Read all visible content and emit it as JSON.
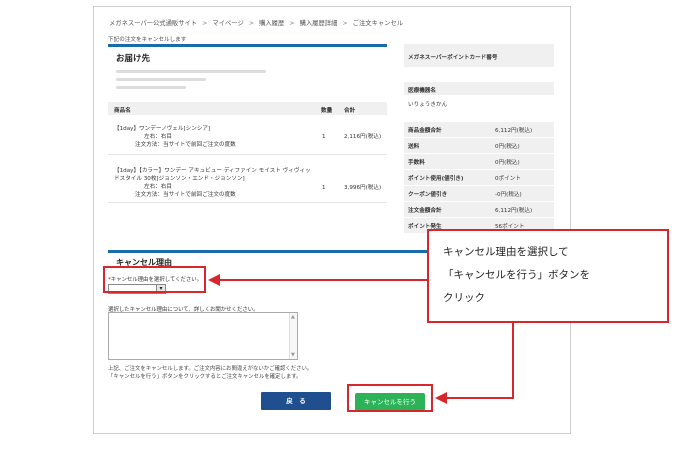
{
  "breadcrumb": {
    "items": [
      "メガネスーパー公式通販サイト",
      "マイページ",
      "購入履歴",
      "購入履歴詳細",
      "ご注文キャンセル"
    ],
    "separator": ">"
  },
  "top_note": "下記の注文をキャンセルします",
  "shipping": {
    "title": "お届け先"
  },
  "items": {
    "headers": {
      "name": "商品名",
      "qty": "数量",
      "total": "合計"
    },
    "rows": [
      {
        "name": "【1day】ワンデーノヴェル[シンシア]",
        "side": "左右：右目",
        "method": "注文方法：当サイトで前回ご注文の度数",
        "qty": "1",
        "price": "2,116円(税込)"
      },
      {
        "name": "【1day】【カラー】ワンデー アキュビュー ディファイン モイスト ヴィヴィッドスタイル 30枚[ジョンソン・エンド・ジョンソン]",
        "side": "左右：右目",
        "method": "注文方法：当サイトで前回ご注文の度数",
        "qty": "1",
        "price": "3,996円(税込)"
      }
    ]
  },
  "card": {
    "label": "メガネスーパーポイントカード番号"
  },
  "store": {
    "label": "医療機器名",
    "value": "いりょうきかん"
  },
  "summary": [
    {
      "label": "商品金額合計",
      "value": "6,112円(税込)"
    },
    {
      "label": "送料",
      "value": "0円(税込)"
    },
    {
      "label": "手数料",
      "value": "0円(税込)"
    },
    {
      "label": "ポイント使用(値引き)",
      "value": "0ポイント"
    },
    {
      "label": "クーポン値引き",
      "value": "-0円(税込)"
    },
    {
      "label": "注文金額合計",
      "value": "6,112円(税込)"
    },
    {
      "label": "ポイント発生",
      "value": "56ポイント"
    }
  ],
  "cancel": {
    "title": "キャンセル理由",
    "required_mark": "*",
    "select_label": "キャンセル理由を選択してください。",
    "select_value": "",
    "detail_label": "選択したキャンセル理由について、詳しくお聞かせください。",
    "notice_line1": "上記、ご注文をキャンセルします。ご注文内容にお間違えがないかご確認ください。",
    "notice_line2": "「キャンセルを行う」ボタンをクリックするとご注文キャンセルを確定します。"
  },
  "buttons": {
    "back": "戻　る",
    "cancel": "キャンセルを行う"
  },
  "callout": {
    "line1": "キャンセル理由を選択して",
    "line2": "「キャンセルを行う」ボタンを",
    "line3": "クリック"
  },
  "colors": {
    "accent_blue": "#1a6ca8",
    "button_blue": "#1f4f8e",
    "button_green": "#2cb357",
    "highlight_red": "#d8262d"
  }
}
